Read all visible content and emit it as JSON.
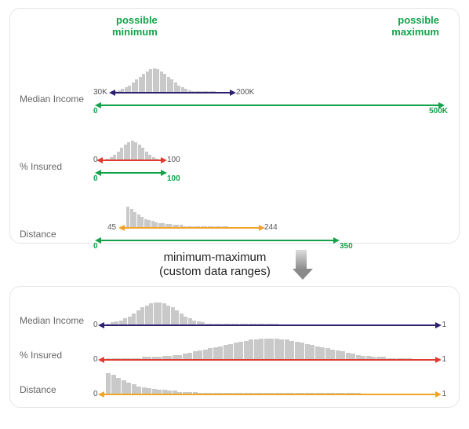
{
  "colors": {
    "accent_green": "#13a24a",
    "navy": "#2b2170",
    "red": "#e03b2f",
    "amber": "#f0a428",
    "hist_grey": "#c9c9c9"
  },
  "panel_top": {
    "header_left": "possible\nminimum",
    "header_right": "possible\nmaximum",
    "rows": {
      "median_income": {
        "label": "Median Income",
        "data_arrow": {
          "min": "30K",
          "max": "200K",
          "color": "navy"
        },
        "possible_arrow": {
          "min": "0",
          "max": "500K",
          "color": "green"
        }
      },
      "pct_insured": {
        "label": "% Insured",
        "data_arrow": {
          "min": "0",
          "max": "100",
          "color": "red"
        },
        "possible_arrow": {
          "min": "0",
          "max": "100",
          "color": "green"
        }
      },
      "distance": {
        "label": "Distance",
        "data_arrow": {
          "min": "45",
          "max": "244",
          "color": "amber"
        },
        "possible_arrow": {
          "min": "0",
          "max": "350",
          "color": "green"
        }
      }
    }
  },
  "middle": {
    "caption_line1": "minimum-maximum",
    "caption_line2": "(custom data ranges)"
  },
  "panel_bottom": {
    "rows": {
      "median_income": {
        "label": "Median Income",
        "arrow": {
          "min": "0",
          "max": "1",
          "color": "navy"
        }
      },
      "pct_insured": {
        "label": "% Insured",
        "arrow": {
          "min": "0",
          "max": "1",
          "color": "red"
        }
      },
      "distance": {
        "label": "Distance",
        "arrow": {
          "min": "0",
          "max": "1",
          "color": "amber"
        }
      }
    }
  },
  "chart_data": [
    {
      "type": "bar",
      "title": "Median Income distribution (top panel)",
      "xlabel": "",
      "ylabel": "",
      "x_range_data": [
        30000,
        200000
      ],
      "x_range_possible": [
        0,
        500000
      ],
      "values": [
        1,
        2,
        3,
        5,
        7,
        10,
        13,
        16,
        19,
        22,
        24,
        25,
        24,
        22,
        19,
        16,
        13,
        10,
        7,
        5,
        3,
        2,
        1,
        1,
        1,
        1,
        0,
        0,
        0
      ]
    },
    {
      "type": "bar",
      "title": "% Insured distribution (top panel)",
      "x_range_data": [
        0,
        100
      ],
      "x_range_possible": [
        0,
        100
      ],
      "values": [
        1,
        2,
        4,
        7,
        10,
        13,
        15,
        16,
        15,
        13,
        10,
        7,
        4,
        2,
        1
      ]
    },
    {
      "type": "bar",
      "title": "Distance distribution (top panel)",
      "x_range_data": [
        45,
        244
      ],
      "x_range_possible": [
        0,
        350
      ],
      "values": [
        20,
        18,
        15,
        12,
        10,
        8,
        7,
        6,
        5,
        4,
        4,
        3,
        3,
        2,
        2,
        2,
        1,
        1,
        1,
        1,
        1,
        1,
        1,
        1,
        1,
        1,
        1,
        1,
        1
      ]
    },
    {
      "type": "bar",
      "title": "Median Income normalized (bottom panel)",
      "x_range_data": [
        0,
        1
      ],
      "values": [
        1,
        2,
        3,
        4,
        6,
        8,
        11,
        14,
        17,
        19,
        21,
        22,
        22,
        21,
        19,
        17,
        14,
        11,
        8,
        6,
        4,
        3,
        2,
        1,
        1,
        1,
        1,
        0,
        0,
        0,
        0,
        0,
        0,
        0,
        0,
        0,
        0,
        0,
        0,
        0
      ]
    },
    {
      "type": "bar",
      "title": "% Insured normalized (bottom panel)",
      "x_range_data": [
        0,
        1
      ],
      "values": [
        1,
        1,
        1,
        1,
        1,
        1,
        1,
        2,
        2,
        2,
        2,
        3,
        3,
        4,
        4,
        5,
        6,
        7,
        8,
        9,
        10,
        11,
        12,
        13,
        14,
        15,
        16,
        17,
        18,
        18,
        19,
        19,
        19,
        19,
        18,
        18,
        17,
        16,
        15,
        14,
        13,
        12,
        11,
        10,
        9,
        8,
        7,
        6,
        5,
        4,
        3,
        3,
        2,
        2,
        2,
        1,
        1,
        1,
        1,
        1
      ]
    },
    {
      "type": "bar",
      "title": "Distance normalized (bottom panel)",
      "x_range_data": [
        0,
        1
      ],
      "values": [
        22,
        20,
        17,
        14,
        12,
        10,
        8,
        7,
        6,
        5,
        4,
        4,
        3,
        3,
        2,
        2,
        2,
        2,
        1,
        1,
        1,
        1,
        1,
        1,
        1,
        1,
        1,
        1,
        1,
        1,
        1,
        1,
        1,
        1,
        1,
        1,
        1,
        1,
        1,
        1,
        1,
        1,
        1,
        1,
        1,
        1,
        1,
        1,
        1,
        1
      ]
    }
  ]
}
